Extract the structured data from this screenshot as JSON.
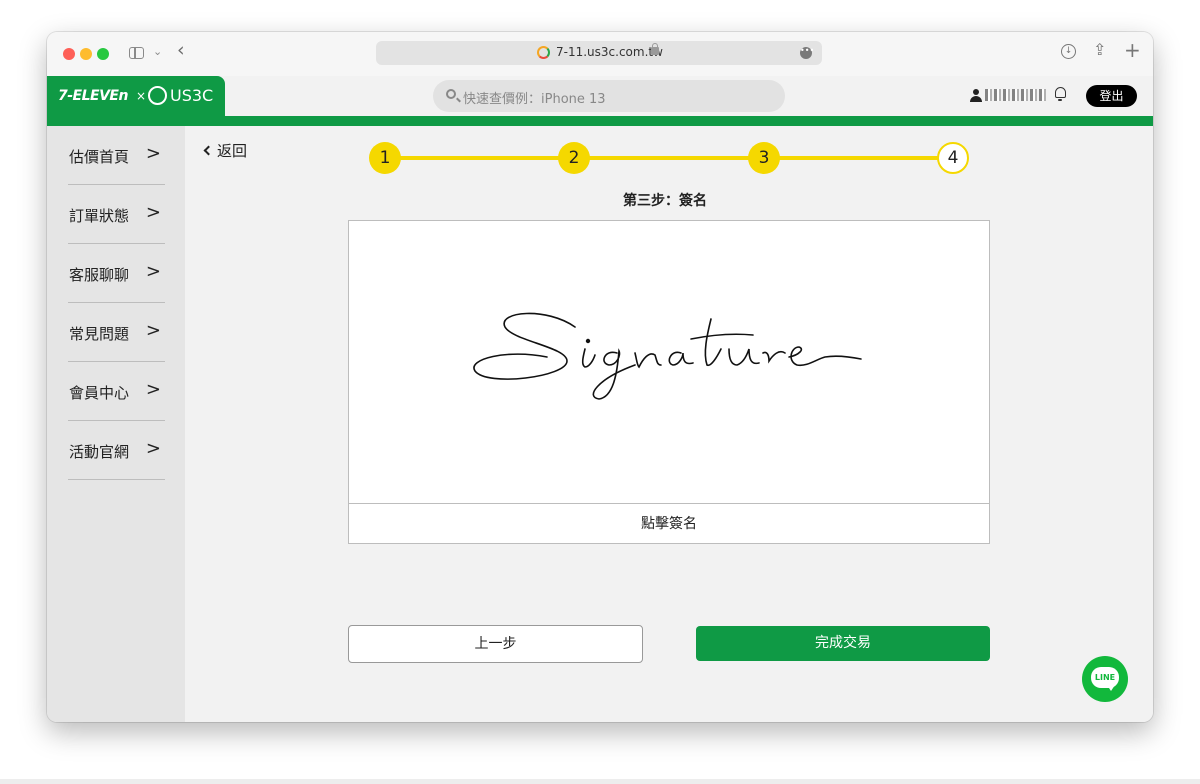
{
  "browser": {
    "url": "7-11.us3c.com.tw",
    "back_glyph": "‹",
    "sidebar_chevron": "⌄"
  },
  "header": {
    "logo_brand": "7-ELEVEn",
    "logo_separator": "×",
    "logo_partner": "US3C",
    "search_placeholder": "快速查價例：iPhone 13",
    "logout_label": "登出"
  },
  "sidebar": {
    "items": [
      {
        "label": "估價首頁"
      },
      {
        "label": "訂單狀態"
      },
      {
        "label": "客服聊聊"
      },
      {
        "label": "常見問題"
      },
      {
        "label": "會員中心"
      },
      {
        "label": "活動官網"
      }
    ]
  },
  "main": {
    "back_label": "返回",
    "steps": [
      "1",
      "2",
      "3",
      "4"
    ],
    "current_step": 4,
    "step_title": "第三步：簽名",
    "signature_text": "Signature",
    "signature_button": "點擊簽名",
    "prev_label": "上一步",
    "finish_label": "完成交易",
    "line_label": "LINE"
  },
  "colors": {
    "brand_green": "#0f9a45",
    "step_yellow": "#f5d800",
    "line_green": "#12b83c"
  }
}
